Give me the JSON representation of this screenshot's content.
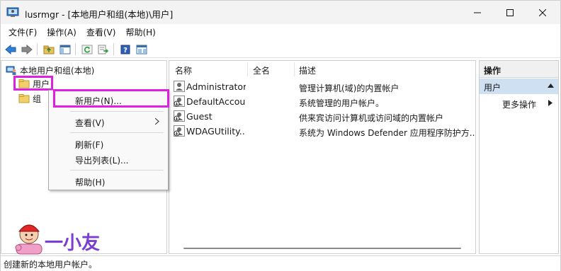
{
  "window": {
    "title": "lusrmgr - [本地用户和组(本地)\\用户]"
  },
  "menubar": {
    "items": [
      {
        "label": "文件(F)"
      },
      {
        "label": "操作(A)"
      },
      {
        "label": "查看(V)"
      },
      {
        "label": "帮助(H)"
      }
    ]
  },
  "tree": {
    "root_label": "本地用户和组(本地)",
    "users_label": "用户",
    "groups_label": "组"
  },
  "list": {
    "columns": [
      "名称",
      "全名",
      "描述"
    ],
    "rows": [
      {
        "name": "Administrator",
        "fullname": "",
        "description": "管理计算机(域)的内置帐户"
      },
      {
        "name": "DefaultAccou...",
        "fullname": "",
        "description": "系统管理的用户帐户。"
      },
      {
        "name": "Guest",
        "fullname": "",
        "description": "供来宾访问计算机或访问域的内置帐户"
      },
      {
        "name": "WDAGUtility...",
        "fullname": "",
        "description": "系统为 Windows Defender 应用程序防护方..."
      }
    ]
  },
  "actions": {
    "title": "操作",
    "section": "用户",
    "more": "更多操作"
  },
  "context_menu": {
    "items": [
      {
        "label": "新用户(N)..."
      },
      {
        "label": "查看(V)"
      },
      {
        "label": "刷新(F)"
      },
      {
        "label": "导出列表(L)..."
      },
      {
        "label": "帮助(H)"
      }
    ]
  },
  "status": {
    "text": "创建新的本地用户帐户。"
  },
  "watermark": {
    "text": "一小友"
  },
  "colors": {
    "highlight": "#e020e0",
    "selection": "#cfe0f3"
  }
}
